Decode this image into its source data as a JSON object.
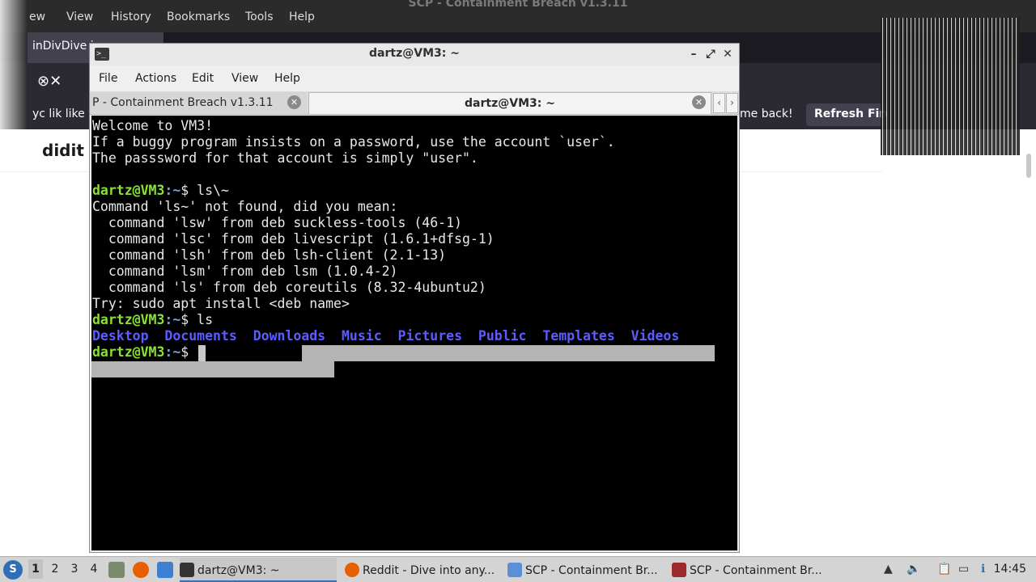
{
  "browser": {
    "window_title": "SCP - Containment Breach v1.3.11",
    "menu": [
      "ew",
      "View",
      "History",
      "Bookmarks",
      "Tools",
      "Help"
    ],
    "tab_title": "inDivDive in",
    "notice_left": "yc lik like y",
    "notice_right": "me back!",
    "refresh_label": "Refresh Fire",
    "site_logo": "didit"
  },
  "terminal": {
    "title": "dartz@VM3: ~",
    "menu": [
      "File",
      "Actions",
      "Edit",
      "View",
      "Help"
    ],
    "tabs": [
      "P - Containment Breach v1.3.11",
      "dartz@VM3: ~"
    ],
    "prompt_user": "dartz@VM3",
    "prompt_path": ":~",
    "prompt_symbol": "$",
    "lines": [
      "Welcome to VM3!",
      "If a buggy program insists on a password, use the account `user`.",
      "The passsword for that account is simply \"user\"."
    ],
    "cmd1": " ls\\~",
    "output1": [
      "Command 'ls~' not found, did you mean:",
      "  command 'lsw' from deb suckless-tools (46-1)",
      "  command 'lsc' from deb livescript (1.6.1+dfsg-1)",
      "  command 'lsh' from deb lsh-client (2.1-13)",
      "  command 'lsm' from deb lsm (1.0.4-2)",
      "  command 'ls' from deb coreutils (8.32-4ubuntu2)",
      "Try: sudo apt install <deb name>"
    ],
    "cmd2": " ls",
    "dirs": [
      "Desktop",
      "Documents",
      "Downloads",
      "Music",
      "Pictures",
      "Public",
      "Templates",
      "Videos"
    ]
  },
  "taskbar": {
    "workspaces": [
      "1",
      "2",
      "3",
      "4"
    ],
    "tasks": [
      "dartz@VM3: ~",
      "Reddit - Dive into any...",
      "SCP - Containment Br...",
      "SCP - Containment Br..."
    ],
    "clock": "14:45"
  },
  "colors": {
    "prompt_green": "#8ae234",
    "prompt_blue": "#729fcf",
    "dir_blue": "#5c5cff",
    "terminal_bg": "#000000"
  }
}
